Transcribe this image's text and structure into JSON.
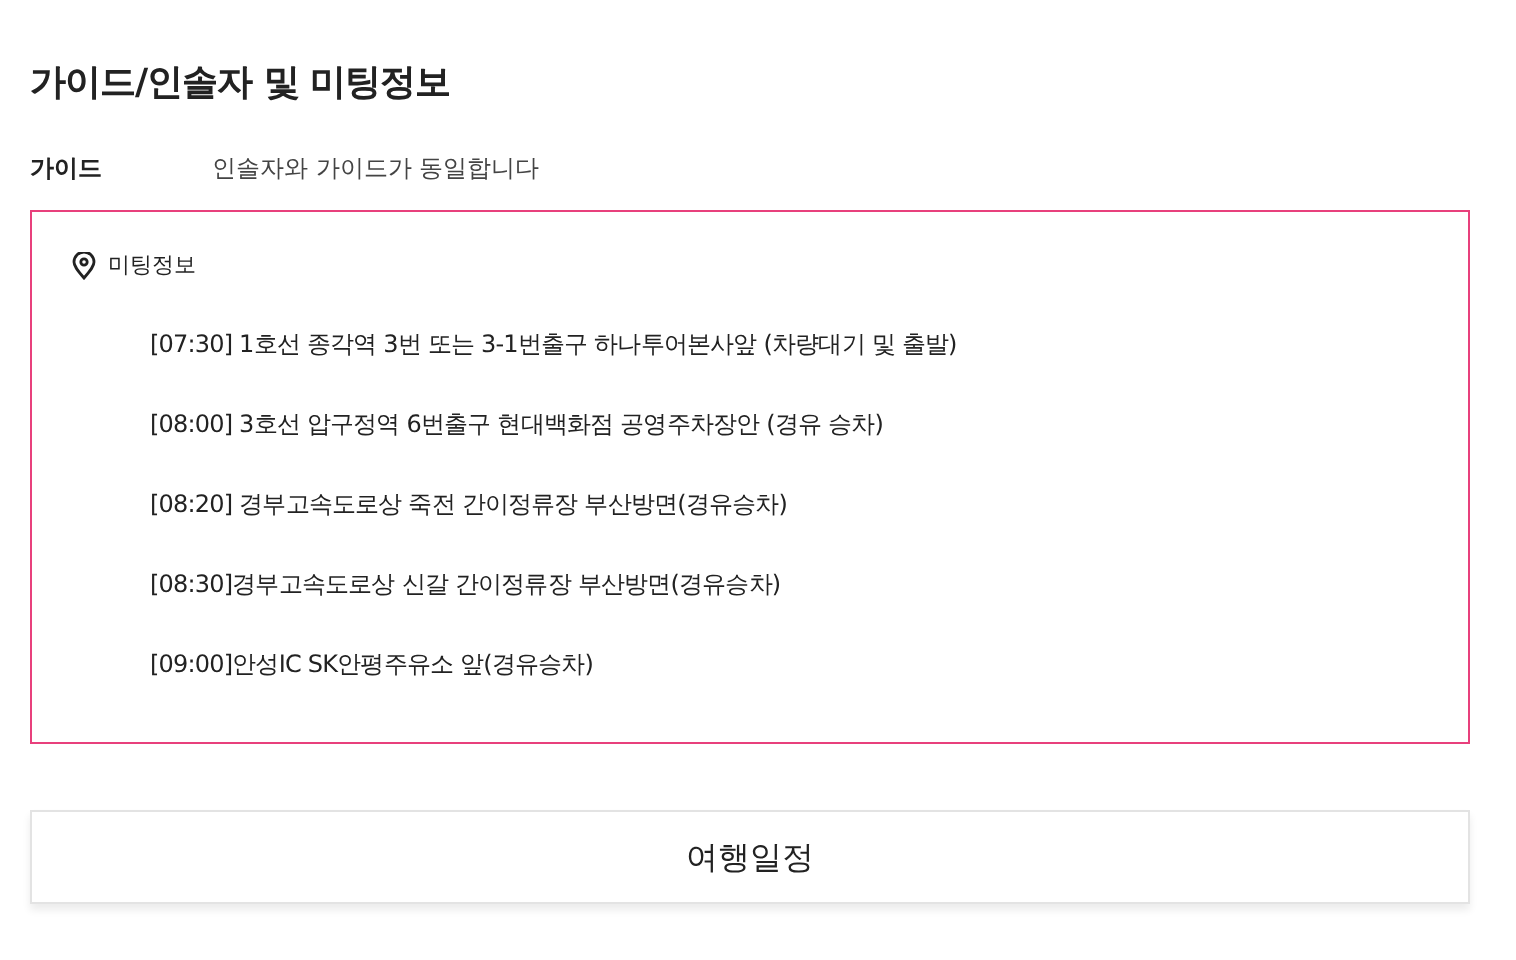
{
  "section_title": "가이드/인솔자 및 미팅정보",
  "guide": {
    "label": "가이드",
    "value": "인솔자와 가이드가 동일합니다"
  },
  "meeting": {
    "title": "미팅정보",
    "items": [
      "[07:30] 1호선 종각역 3번 또는 3-1번출구 하나투어본사앞 (차량대기 및 출발)",
      "[08:00] 3호선 압구정역 6번출구 현대백화점 공영주차장안 (경유 승차)",
      "[08:20] 경부고속도로상 죽전 간이정류장 부산방면(경유승차)",
      "[08:30]경부고속도로상 신갈 간이정류장 부산방면(경유승차)",
      "[09:00]안성IC SK안평주유소 앞(경유승차)"
    ]
  },
  "schedule_button": "여행일정"
}
